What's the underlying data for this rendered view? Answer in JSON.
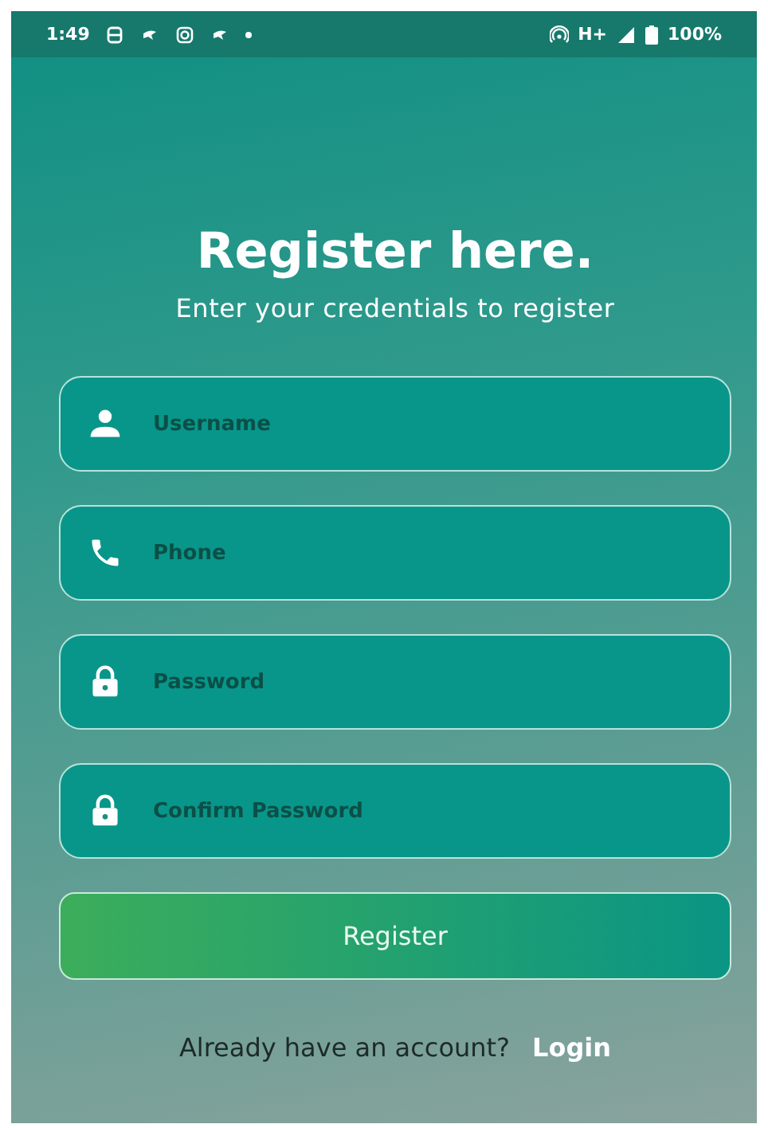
{
  "status_bar": {
    "time": "1:49",
    "network": "H+",
    "battery": "100%"
  },
  "title": "Register here.",
  "subtitle": "Enter your credentials to register",
  "fields": [
    {
      "kind": "person",
      "placeholder": "Username"
    },
    {
      "kind": "phone",
      "placeholder": "Phone"
    },
    {
      "kind": "lock",
      "placeholder": "Password"
    },
    {
      "kind": "lock",
      "placeholder": "Confirm Password"
    }
  ],
  "button": "Register",
  "footer": {
    "text": "Already have an account?",
    "link": "Login"
  }
}
